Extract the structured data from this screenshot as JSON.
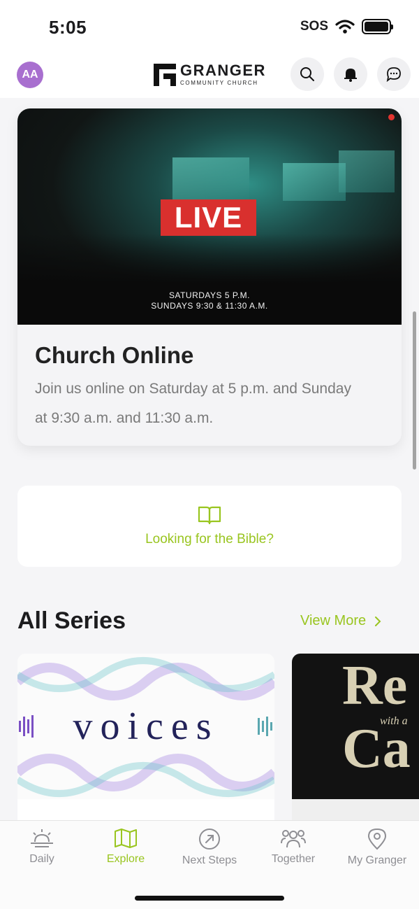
{
  "status": {
    "time": "5:05",
    "sos": "SOS"
  },
  "header": {
    "avatar_initials": "AA",
    "logo_name": "GRANGER",
    "logo_sub": "COMMUNITY CHURCH",
    "search_icon": "search-icon",
    "bell_icon": "bell-icon",
    "chat_icon": "chat-icon"
  },
  "hero_card": {
    "live_label": "LIVE",
    "times_line1": "SATURDAYS 5 P.M.",
    "times_line2": "SUNDAYS 9:30 & 11:30 A.M.",
    "title": "Church Online",
    "description": "Join us online on Saturday at 5 p.m. and Sunday at 9:30 a.m. and 11:30 a.m."
  },
  "bible": {
    "label": "Looking for the Bible?",
    "icon": "book-icon"
  },
  "series": {
    "title": "All Series",
    "view_more": "View More",
    "items": [
      {
        "name": "voices"
      },
      {
        "name": "Re",
        "subtitle": "with a",
        "second": "Ca"
      }
    ]
  },
  "tabs": [
    {
      "label": "Daily",
      "icon": "sunrise-icon",
      "active": false
    },
    {
      "label": "Explore",
      "icon": "map-icon",
      "active": true
    },
    {
      "label": "Next Steps",
      "icon": "arrow-circle-icon",
      "active": false
    },
    {
      "label": "Together",
      "icon": "group-icon",
      "active": false
    },
    {
      "label": "My Granger",
      "icon": "location-pin-icon",
      "active": false
    }
  ],
  "colors": {
    "accent": "#99c51f",
    "live_red": "#d9302e",
    "avatar": "#a86fcf"
  }
}
